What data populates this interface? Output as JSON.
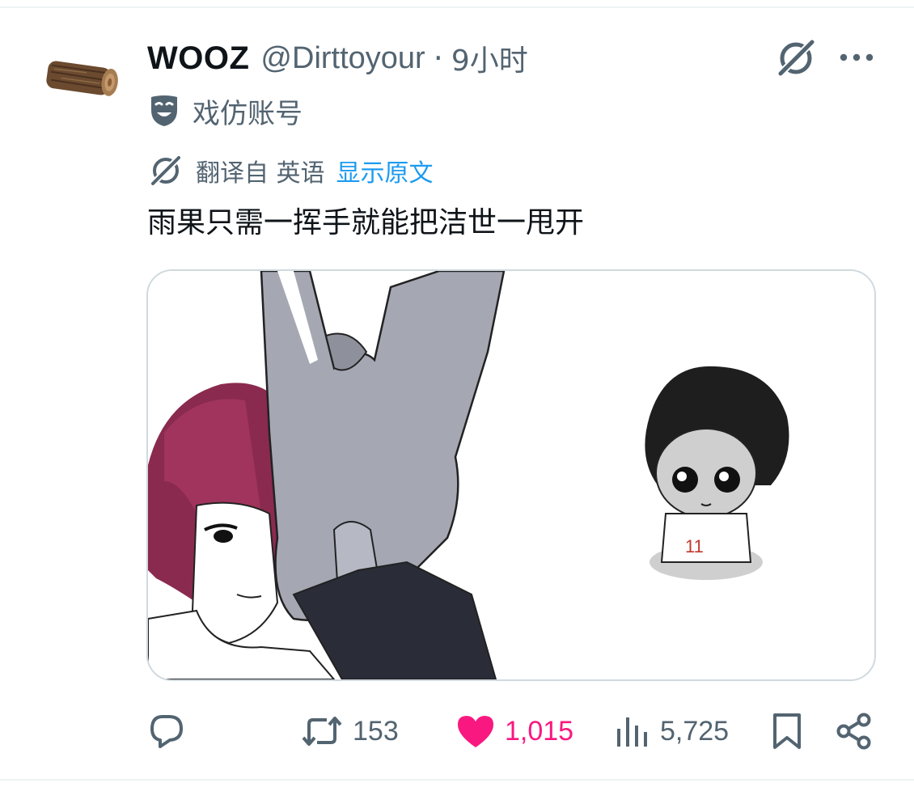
{
  "tweet": {
    "author": {
      "display_name": "WOOZ",
      "handle": "@Dirttoyour",
      "separator": "·",
      "time": "9小时",
      "avatar_icon": "wood-log-avatar"
    },
    "label": {
      "icon": "parody-mask-icon",
      "text": "戏仿账号"
    },
    "translation": {
      "icon": "grok-icon",
      "translated_from": "翻译自 英语",
      "show_original": "显示原文"
    },
    "text": "雨果只需一挥手就能把洁世一甩开",
    "media": {
      "description_icon": "anime-illustration",
      "jersey_number": "11"
    },
    "actions": {
      "reply": {
        "icon": "reply-icon",
        "count": ""
      },
      "retweet": {
        "icon": "retweet-icon",
        "count": "153"
      },
      "like": {
        "icon": "heart-icon",
        "count": "1,015",
        "liked": true
      },
      "views": {
        "icon": "views-icon",
        "count": "5,725"
      },
      "bookmark": {
        "icon": "bookmark-icon"
      },
      "share": {
        "icon": "share-icon"
      }
    }
  },
  "colors": {
    "text_primary": "#0f1419",
    "text_secondary": "#536471",
    "link": "#1d9bf0",
    "like": "#f91880",
    "border": "#cfd9de"
  }
}
